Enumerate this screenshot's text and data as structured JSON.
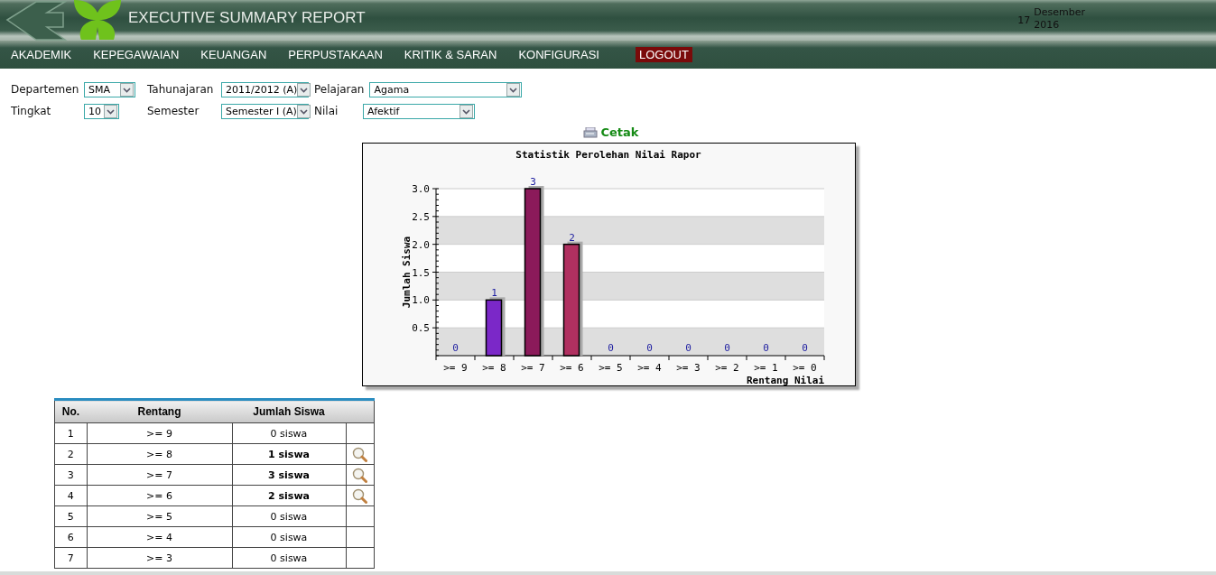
{
  "header": {
    "title": "EXECUTIVE SUMMARY REPORT",
    "date_day": "17",
    "date_month": "Desember",
    "date_year": "2016"
  },
  "menu": [
    {
      "label": "AKADEMIK",
      "kind": "item"
    },
    {
      "label": "KEPEGAWAIAN",
      "kind": "item"
    },
    {
      "label": "KEUANGAN",
      "kind": "item"
    },
    {
      "label": "PERPUSTAKAAN",
      "kind": "item"
    },
    {
      "label": "KRITIK & SARAN",
      "kind": "item"
    },
    {
      "label": "KONFIGURASI",
      "kind": "item"
    },
    {
      "label": "LOGOUT",
      "kind": "logout"
    }
  ],
  "filters": [
    [
      {
        "label": "Departemen",
        "value": "SMA"
      },
      {
        "label": "Tahunajaran",
        "value": "2011/2012 (A)"
      },
      {
        "label": "Pelajaran",
        "value": "Agama"
      }
    ],
    [
      {
        "label": "Tingkat",
        "value": "10"
      },
      {
        "label": "Semester",
        "value": "Semester I (A)"
      },
      {
        "label": "Nilai",
        "value": "Afektif"
      }
    ]
  ],
  "print_link": "Cetak",
  "chart": {
    "chart_data": {
      "type": "bar",
      "title": "Statistik Perolehan Nilai Rapor",
      "xlabel": "Rentang Nilai",
      "ylabel": "Jumlah Siswa",
      "categories": [
        ">= 9",
        ">= 8",
        ">= 7",
        ">= 6",
        ">= 5",
        ">= 4",
        ">= 3",
        ">= 2",
        ">= 1",
        ">= 0"
      ],
      "series": [
        {
          "colors": [
            null,
            "#7b28c8",
            "#8b1a5a",
            "#b03060",
            null,
            null,
            null,
            null,
            null,
            null
          ],
          "values": [
            0,
            1,
            3,
            2,
            0,
            0,
            0,
            0,
            0,
            0
          ]
        }
      ],
      "ylim": [
        0,
        3
      ],
      "yticks": [
        {
          "value": 0.5,
          "label": "0.5"
        },
        {
          "value": 1,
          "label": "1.0"
        },
        {
          "value": 1.5,
          "label": "1.5"
        },
        {
          "value": 2,
          "label": "2.0"
        },
        {
          "value": 2.5,
          "label": "2.5"
        },
        {
          "value": 3,
          "label": "3.0"
        }
      ],
      "grid": true,
      "data_labels": true
    }
  },
  "table": {
    "columns": [
      "No.",
      "Rentang",
      "Jumlah Siswa"
    ],
    "rows": [
      {
        "no": "1",
        "range": ">= 9",
        "count": "0 siswa",
        "detail": false
      },
      {
        "no": "2",
        "range": ">= 8",
        "count": "1 siswa",
        "detail": true
      },
      {
        "no": "3",
        "range": ">= 7",
        "count": "3 siswa",
        "detail": true
      },
      {
        "no": "4",
        "range": ">= 6",
        "count": "2 siswa",
        "detail": true
      },
      {
        "no": "5",
        "range": ">= 5",
        "count": "0 siswa",
        "detail": false
      },
      {
        "no": "6",
        "range": ">= 4",
        "count": "0 siswa",
        "detail": false
      },
      {
        "no": "7",
        "range": ">= 3",
        "count": "0 siswa",
        "detail": false
      }
    ]
  }
}
